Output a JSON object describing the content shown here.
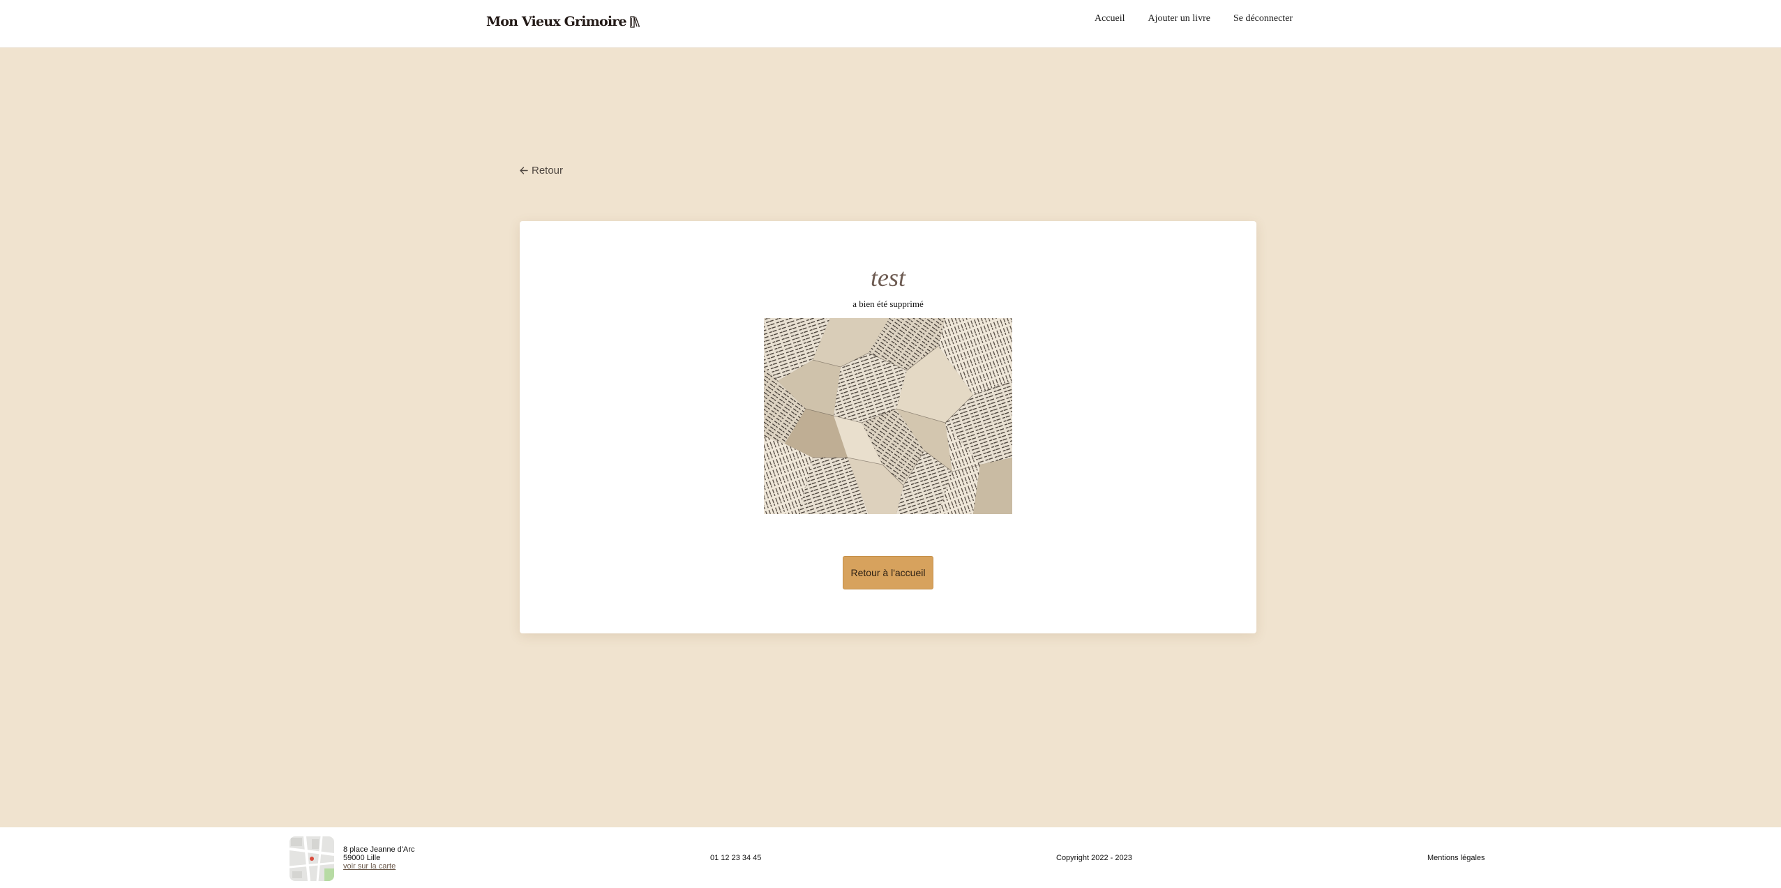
{
  "header": {
    "logo_text": "Mon Vieux Grimoire",
    "nav": [
      {
        "label": "Accueil"
      },
      {
        "label": "Ajouter un livre"
      },
      {
        "label": "Se déconnecter"
      }
    ]
  },
  "back_link": {
    "label": "Retour",
    "icon": "arrow-left-icon"
  },
  "confirmation": {
    "book_title": "test",
    "message": "a bien été supprimé",
    "image": "crumpled-book-pages",
    "button_label": "Retour à l'accueil"
  },
  "footer": {
    "map_icon": "map-thumbnail",
    "address_line1": "8 place Jeanne d'Arc",
    "address_line2": "59000 Lille",
    "map_link": "voir sur la carte",
    "phone": "01 12 23 34 45",
    "copyright": "Copyright 2022 - 2023",
    "legal": "Mentions légales"
  },
  "colors": {
    "page_background": "#f0e3cf",
    "card_background": "#ffffff",
    "button_background": "#d7a25d",
    "title_color": "#6d5b52"
  }
}
